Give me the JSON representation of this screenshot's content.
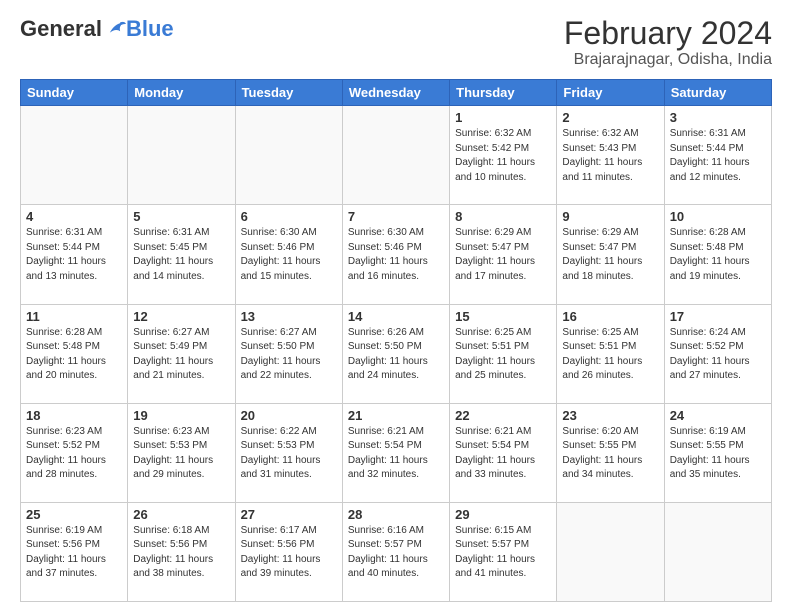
{
  "header": {
    "logo_general": "General",
    "logo_blue": "Blue",
    "title": "February 2024",
    "subtitle": "Brajarajnagar, Odisha, India"
  },
  "weekdays": [
    "Sunday",
    "Monday",
    "Tuesday",
    "Wednesday",
    "Thursday",
    "Friday",
    "Saturday"
  ],
  "weeks": [
    [
      {
        "day": "",
        "info": ""
      },
      {
        "day": "",
        "info": ""
      },
      {
        "day": "",
        "info": ""
      },
      {
        "day": "",
        "info": ""
      },
      {
        "day": "1",
        "info": "Sunrise: 6:32 AM\nSunset: 5:42 PM\nDaylight: 11 hours\nand 10 minutes."
      },
      {
        "day": "2",
        "info": "Sunrise: 6:32 AM\nSunset: 5:43 PM\nDaylight: 11 hours\nand 11 minutes."
      },
      {
        "day": "3",
        "info": "Sunrise: 6:31 AM\nSunset: 5:44 PM\nDaylight: 11 hours\nand 12 minutes."
      }
    ],
    [
      {
        "day": "4",
        "info": "Sunrise: 6:31 AM\nSunset: 5:44 PM\nDaylight: 11 hours\nand 13 minutes."
      },
      {
        "day": "5",
        "info": "Sunrise: 6:31 AM\nSunset: 5:45 PM\nDaylight: 11 hours\nand 14 minutes."
      },
      {
        "day": "6",
        "info": "Sunrise: 6:30 AM\nSunset: 5:46 PM\nDaylight: 11 hours\nand 15 minutes."
      },
      {
        "day": "7",
        "info": "Sunrise: 6:30 AM\nSunset: 5:46 PM\nDaylight: 11 hours\nand 16 minutes."
      },
      {
        "day": "8",
        "info": "Sunrise: 6:29 AM\nSunset: 5:47 PM\nDaylight: 11 hours\nand 17 minutes."
      },
      {
        "day": "9",
        "info": "Sunrise: 6:29 AM\nSunset: 5:47 PM\nDaylight: 11 hours\nand 18 minutes."
      },
      {
        "day": "10",
        "info": "Sunrise: 6:28 AM\nSunset: 5:48 PM\nDaylight: 11 hours\nand 19 minutes."
      }
    ],
    [
      {
        "day": "11",
        "info": "Sunrise: 6:28 AM\nSunset: 5:48 PM\nDaylight: 11 hours\nand 20 minutes."
      },
      {
        "day": "12",
        "info": "Sunrise: 6:27 AM\nSunset: 5:49 PM\nDaylight: 11 hours\nand 21 minutes."
      },
      {
        "day": "13",
        "info": "Sunrise: 6:27 AM\nSunset: 5:50 PM\nDaylight: 11 hours\nand 22 minutes."
      },
      {
        "day": "14",
        "info": "Sunrise: 6:26 AM\nSunset: 5:50 PM\nDaylight: 11 hours\nand 24 minutes."
      },
      {
        "day": "15",
        "info": "Sunrise: 6:25 AM\nSunset: 5:51 PM\nDaylight: 11 hours\nand 25 minutes."
      },
      {
        "day": "16",
        "info": "Sunrise: 6:25 AM\nSunset: 5:51 PM\nDaylight: 11 hours\nand 26 minutes."
      },
      {
        "day": "17",
        "info": "Sunrise: 6:24 AM\nSunset: 5:52 PM\nDaylight: 11 hours\nand 27 minutes."
      }
    ],
    [
      {
        "day": "18",
        "info": "Sunrise: 6:23 AM\nSunset: 5:52 PM\nDaylight: 11 hours\nand 28 minutes."
      },
      {
        "day": "19",
        "info": "Sunrise: 6:23 AM\nSunset: 5:53 PM\nDaylight: 11 hours\nand 29 minutes."
      },
      {
        "day": "20",
        "info": "Sunrise: 6:22 AM\nSunset: 5:53 PM\nDaylight: 11 hours\nand 31 minutes."
      },
      {
        "day": "21",
        "info": "Sunrise: 6:21 AM\nSunset: 5:54 PM\nDaylight: 11 hours\nand 32 minutes."
      },
      {
        "day": "22",
        "info": "Sunrise: 6:21 AM\nSunset: 5:54 PM\nDaylight: 11 hours\nand 33 minutes."
      },
      {
        "day": "23",
        "info": "Sunrise: 6:20 AM\nSunset: 5:55 PM\nDaylight: 11 hours\nand 34 minutes."
      },
      {
        "day": "24",
        "info": "Sunrise: 6:19 AM\nSunset: 5:55 PM\nDaylight: 11 hours\nand 35 minutes."
      }
    ],
    [
      {
        "day": "25",
        "info": "Sunrise: 6:19 AM\nSunset: 5:56 PM\nDaylight: 11 hours\nand 37 minutes."
      },
      {
        "day": "26",
        "info": "Sunrise: 6:18 AM\nSunset: 5:56 PM\nDaylight: 11 hours\nand 38 minutes."
      },
      {
        "day": "27",
        "info": "Sunrise: 6:17 AM\nSunset: 5:56 PM\nDaylight: 11 hours\nand 39 minutes."
      },
      {
        "day": "28",
        "info": "Sunrise: 6:16 AM\nSunset: 5:57 PM\nDaylight: 11 hours\nand 40 minutes."
      },
      {
        "day": "29",
        "info": "Sunrise: 6:15 AM\nSunset: 5:57 PM\nDaylight: 11 hours\nand 41 minutes."
      },
      {
        "day": "",
        "info": ""
      },
      {
        "day": "",
        "info": ""
      }
    ]
  ]
}
